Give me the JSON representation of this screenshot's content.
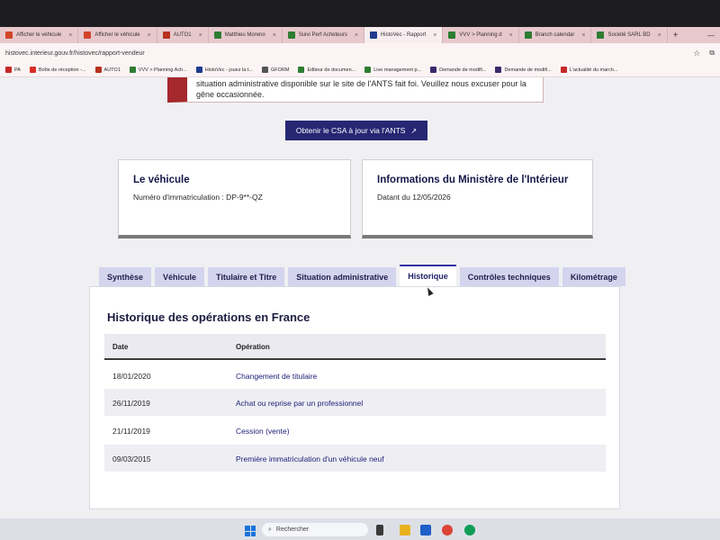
{
  "browser": {
    "tabs": [
      {
        "label": "Afficher le véhicule",
        "color": "#d3452b",
        "active": false
      },
      {
        "label": "Afficher le véhicule",
        "color": "#d3452b",
        "active": false
      },
      {
        "label": "AUTO1",
        "color": "#b83020",
        "active": false
      },
      {
        "label": "Matthieu Moreno",
        "color": "#2e7d32",
        "active": false
      },
      {
        "label": "Suivi Perf Acheteurs",
        "color": "#2e7d32",
        "active": false
      },
      {
        "label": "HistoVec - Rapport",
        "color": "#1f3b8f",
        "active": true
      },
      {
        "label": "VVV > Planning d",
        "color": "#2e7d32",
        "active": false
      },
      {
        "label": "Branch calendar",
        "color": "#2e7d32",
        "active": false
      },
      {
        "label": "Société SARL BD",
        "color": "#2e7d32",
        "active": false
      }
    ],
    "url": "histovec.interieur.gouv.fr/histovec/rapport-vendeur",
    "bookmarks": [
      {
        "label": "PA",
        "color": "#c62828"
      },
      {
        "label": "Boîte de réception -...",
        "color": "#d93025"
      },
      {
        "label": "AUTO1",
        "color": "#b83020"
      },
      {
        "label": "VVV > Planning Ach...",
        "color": "#2e7d32"
      },
      {
        "label": "HistoVec - jouez la t...",
        "color": "#1f3b8f"
      },
      {
        "label": "GFORM",
        "color": "#555555"
      },
      {
        "label": "Editeur de documen...",
        "color": "#2e7d32"
      },
      {
        "label": "Live management p...",
        "color": "#2e7d32"
      },
      {
        "label": "Demande de modifi...",
        "color": "#3b2a6b"
      },
      {
        "label": "Demande de modifi...",
        "color": "#3b2a6b"
      },
      {
        "label": "L'actualité du march...",
        "color": "#c62828"
      }
    ]
  },
  "alert": {
    "text": "situation administrative disponible sur le site de l'ANTS fait foi. Veuillez nous excuser pour la gêne occasionnée."
  },
  "ants_button": {
    "label": "Obtenir le CSA à jour via l'ANTS"
  },
  "vehicle_card": {
    "title": "Le véhicule",
    "line": "Numéro d'immatriculation : DP-9**-QZ"
  },
  "ministry_card": {
    "title": "Informations du Ministère de l'Intérieur",
    "line": "Datant du 12/05/2026"
  },
  "page_tabs": [
    {
      "label": "Synthèse",
      "active": false
    },
    {
      "label": "Véhicule",
      "active": false
    },
    {
      "label": "Titulaire et Titre",
      "active": false
    },
    {
      "label": "Situation administrative",
      "active": false
    },
    {
      "label": "Historique",
      "active": true
    },
    {
      "label": "Contrôles techniques",
      "active": false
    },
    {
      "label": "Kilométrage",
      "active": false
    }
  ],
  "history": {
    "title": "Historique des opérations en France",
    "columns": [
      "Date",
      "Opération"
    ],
    "rows": [
      {
        "date": "18/01/2020",
        "operation": "Changement de titulaire"
      },
      {
        "date": "26/11/2019",
        "operation": "Achat ou reprise par un professionnel"
      },
      {
        "date": "21/11/2019",
        "operation": "Cession (vente)"
      },
      {
        "date": "09/03/2015",
        "operation": "Première immatriculation d'un véhicule neuf"
      }
    ]
  },
  "taskbar": {
    "search_label": "Rechercher"
  }
}
